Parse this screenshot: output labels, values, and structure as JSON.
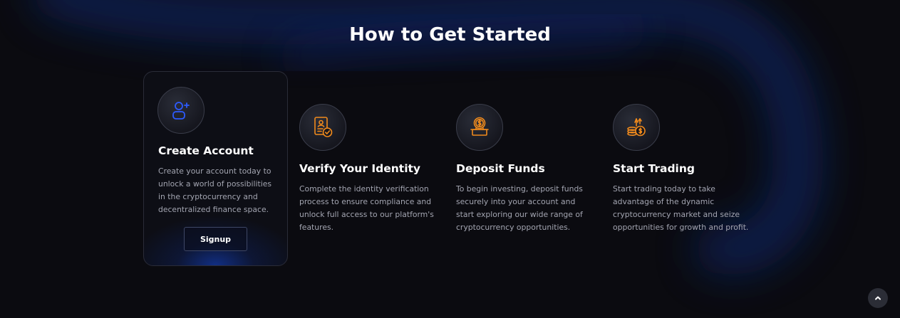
{
  "section": {
    "title": "How to Get Started"
  },
  "steps": [
    {
      "title": "Create Account",
      "description": "Create your account today to unlock a world of possibilities in the cryptocurrency and decentralized finance space.",
      "icon": "user-plus-icon",
      "button_label": "Signup"
    },
    {
      "title": "Verify Your Identity",
      "description": "Complete the identity verification process to ensure compliance and unlock full access to our platform's features.",
      "icon": "id-verified-icon"
    },
    {
      "title": "Deposit Funds",
      "description": "To begin investing, deposit funds securely into your account and start exploring our wide range of cryptocurrency opportunities.",
      "icon": "coin-deposit-icon"
    },
    {
      "title": "Start Trading",
      "description": "Start trading today to take advantage of the dynamic cryptocurrency market and seize opportunities for growth and profit.",
      "icon": "coins-growth-icon"
    }
  ],
  "scroll_top": {
    "icon": "chevron-up-icon"
  },
  "colors": {
    "background": "#0b0b10",
    "accent_blue": "#2d5bff",
    "accent_orange": "#f08a1c",
    "text_muted": "#a3a5b1"
  }
}
